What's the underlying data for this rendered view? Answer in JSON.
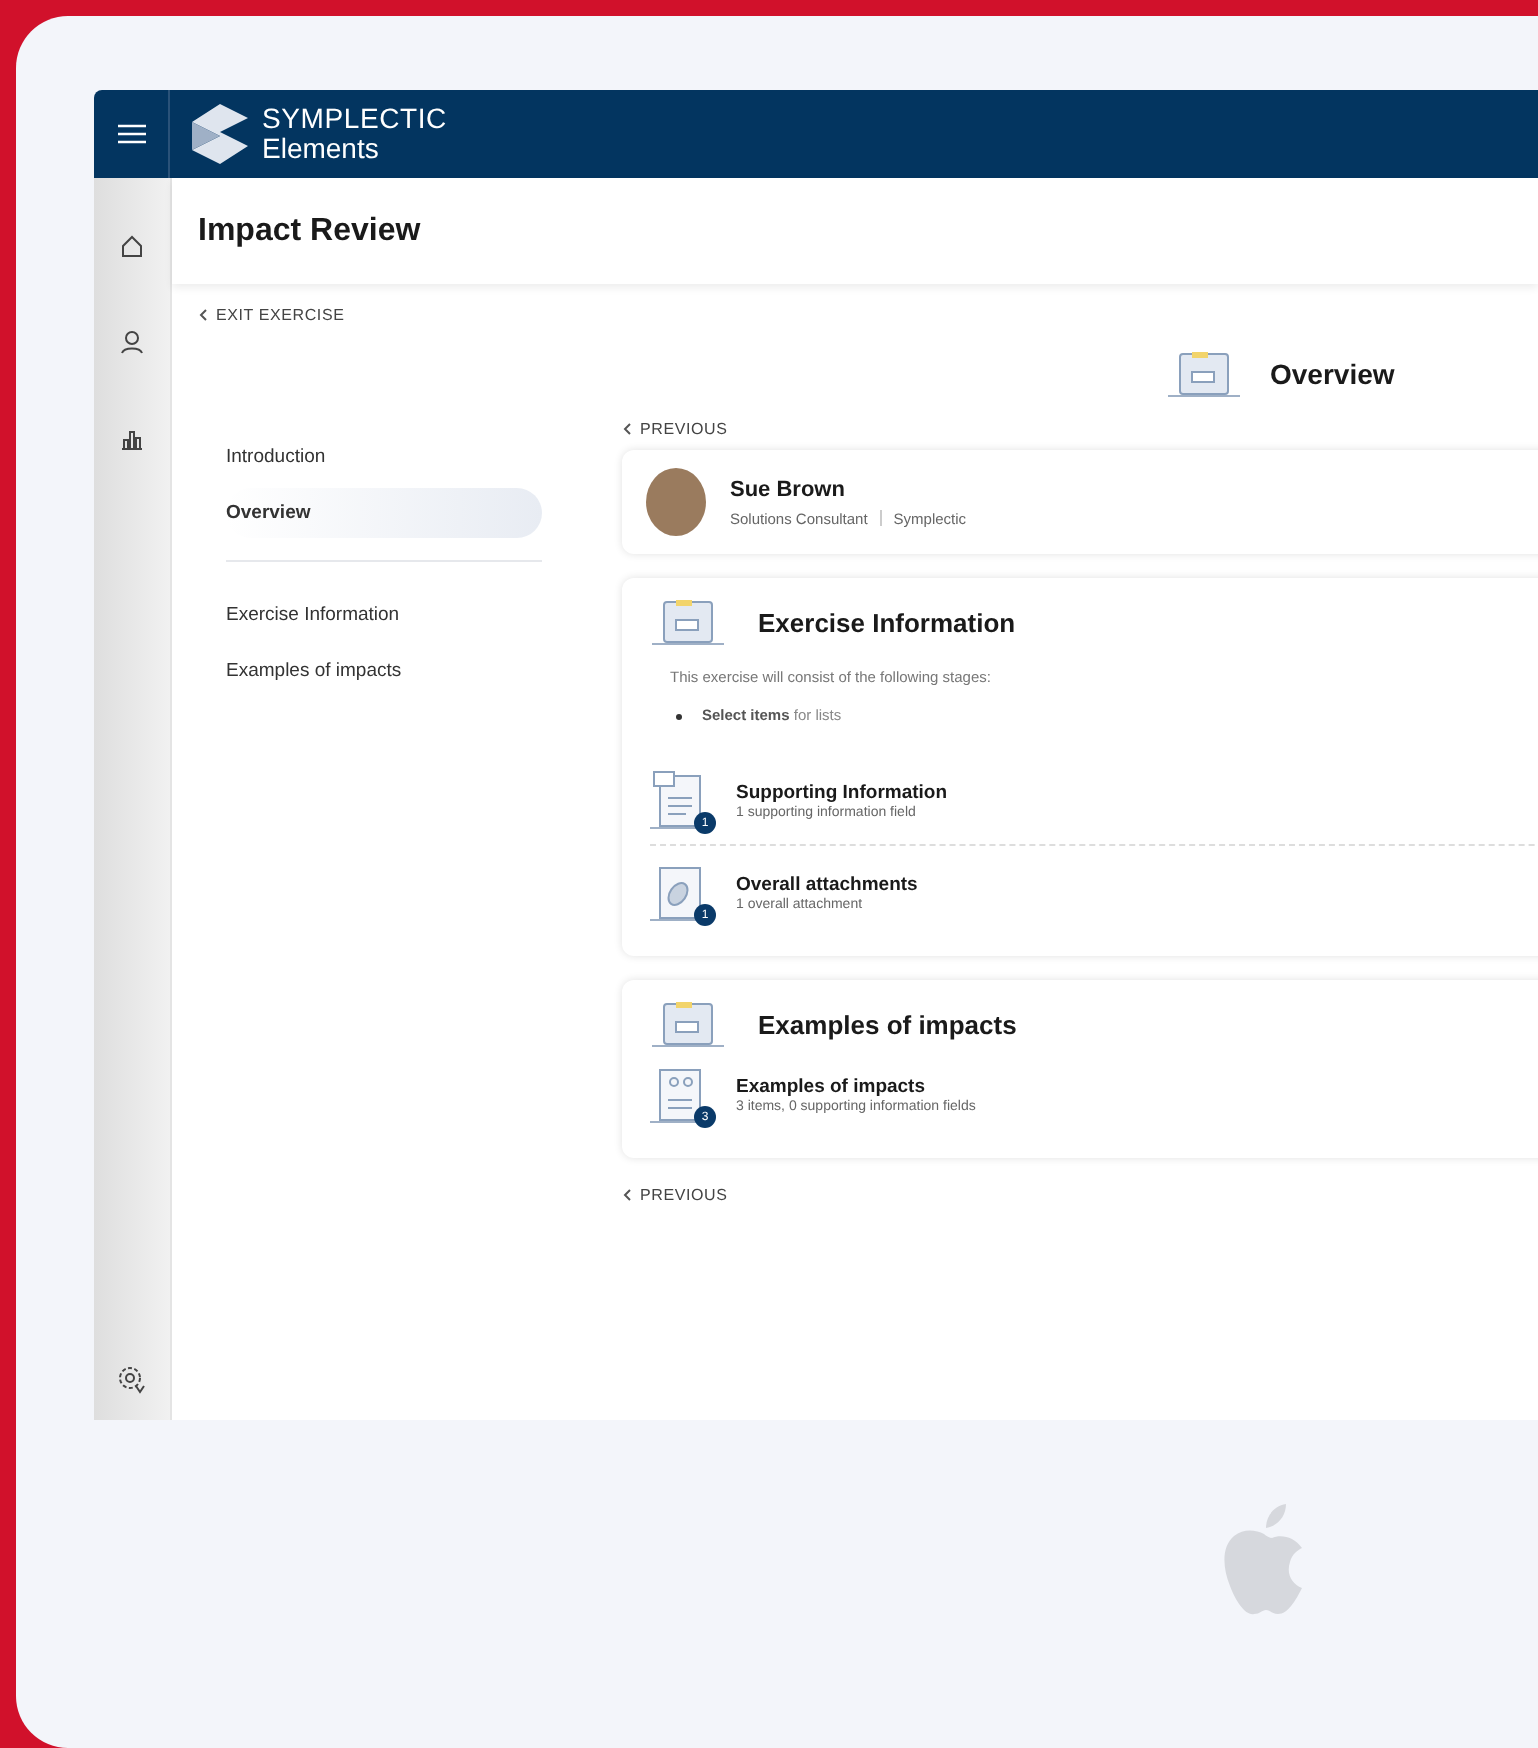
{
  "header": {
    "logo_top": "SYMPLECTIC",
    "logo_bottom": "Elements"
  },
  "page_title": "Impact Review",
  "exit_link": "EXIT EXERCISE",
  "nav_groups": [
    {
      "items": [
        {
          "label": "Introduction",
          "selected": false
        },
        {
          "label": "Overview",
          "selected": true
        }
      ]
    },
    {
      "items": [
        {
          "label": "Exercise Information",
          "selected": false
        },
        {
          "label": "Examples of impacts",
          "selected": false
        }
      ]
    }
  ],
  "section_title": "Overview",
  "top_previous": "PREVIOUS",
  "profile": {
    "name": "Sue Brown",
    "role": "Solutions Consultant",
    "organisation": "Symplectic"
  },
  "cards": [
    {
      "title": "Exercise Information",
      "intro": "This exercise will consist of the following stages:",
      "bullets": [
        "**Select items** for lists"
      ],
      "rows": [
        {
          "kind": "info",
          "title": "Supporting Information",
          "subtitle": "1 supporting information field",
          "count": "1"
        },
        {
          "kind": "attachment",
          "title": "Overall attachments",
          "subtitle": "1 overall attachment",
          "count": "1"
        }
      ]
    },
    {
      "title": "Examples of impacts",
      "rows": [
        {
          "kind": "items",
          "title": "Examples of impacts",
          "subtitle": "3 items, 0 supporting information fields",
          "count": "3"
        }
      ]
    }
  ],
  "bottom_previous": "PREVIOUS"
}
